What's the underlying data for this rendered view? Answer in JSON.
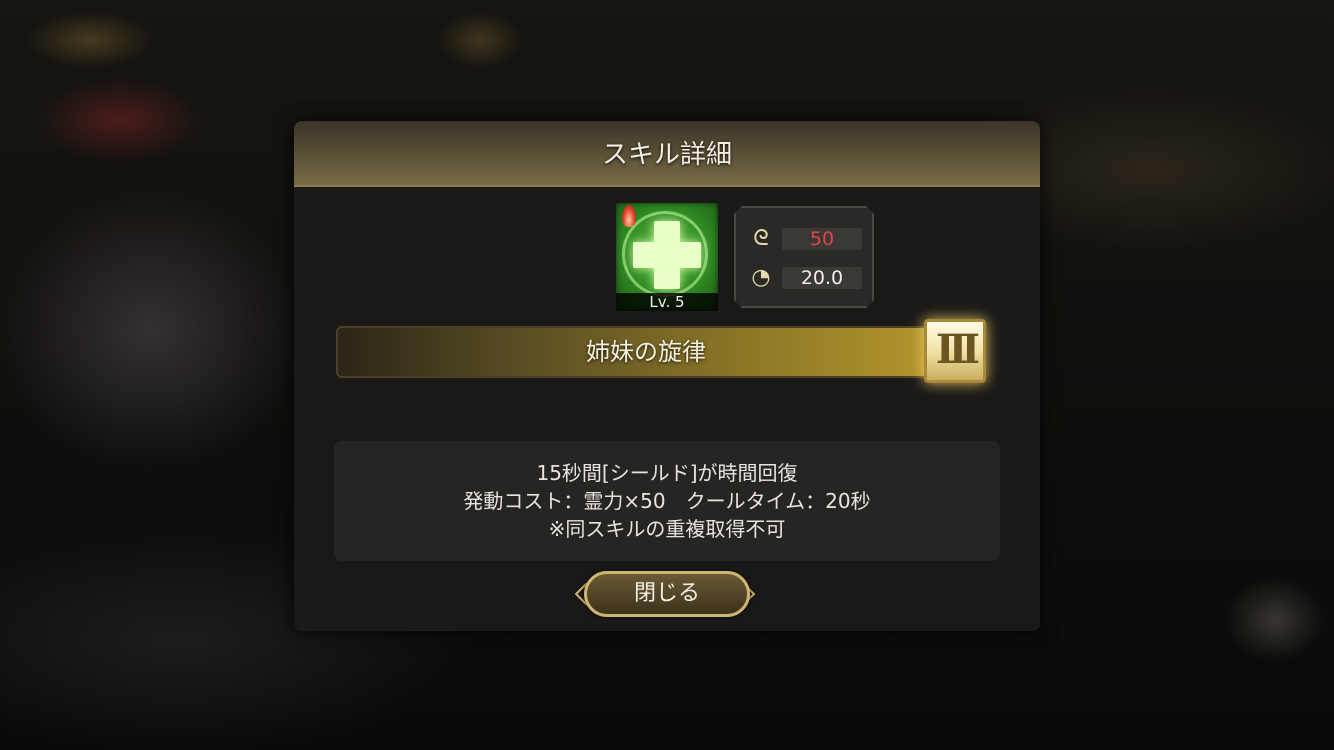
{
  "dialog": {
    "title": "スキル詳細",
    "close_label": "閉じる"
  },
  "skill": {
    "level_label": "Lv. 5",
    "icon": "heal-cross-icon",
    "cost_value": "50",
    "cost_color": "#e0444a",
    "cooldown_value": "20.0",
    "name": "姉妹の旋律",
    "rank": "III"
  },
  "description": {
    "line1": "15秒間[シールド]が時間回復",
    "line2": "発動コスト：霊力×50　クールタイム：20秒",
    "line3": "※同スキルの重複取得不可"
  },
  "colors": {
    "gold_accent": "#cdb671",
    "panel_bg": "#1a1918"
  }
}
